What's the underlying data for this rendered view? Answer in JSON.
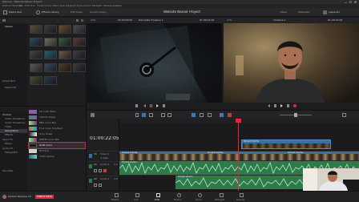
{
  "window": {
    "title": "Resolve - Website Nasser Project"
  },
  "menu": {
    "items": [
      "DaVinci Resolve",
      "File",
      "Edit",
      "Trim",
      "Timeline",
      "Clip",
      "Mark",
      "View",
      "Playback",
      "Fusion",
      "Color",
      "Fairlight",
      "Workspace",
      "Help"
    ]
  },
  "toolbar": {
    "media_pool": "Media Pool",
    "effects_library": "Effects Library",
    "edit_index": "Edit Index",
    "sound_library": "Sound Library",
    "project_name": "Website Nasser Project",
    "edit": "Edit",
    "mixer": "Mixer",
    "metadata": "Metadata",
    "inspector": "Inspector"
  },
  "media_pool": {
    "bins_header": "Master",
    "smart_bins": "Smart Bins",
    "keywords": "Keywords",
    "clip_labels": [
      "Bank 3-1",
      "",
      "",
      "",
      "",
      "",
      "",
      "",
      "",
      "",
      "",
      "",
      "",
      "",
      "",
      "",
      "",
      ""
    ]
  },
  "effects": {
    "toolbox": "Toolbox",
    "tree": [
      "Video Transitions",
      "Audio Transitions",
      "Titles",
      "Generators",
      "Effects",
      "Open FX",
      "Filters",
      "Audio FX",
      "FairlightFX"
    ],
    "favorites": "Favorites",
    "items": [
      "10 Color Bars",
      "100mV Steps",
      "EBU Color Bar",
      "Four Color Gradient",
      "Grey Scale",
      "SMPTE Color Bar",
      "Solid Color",
      "Window",
      "YCbCr Ramp"
    ],
    "item_colors": [
      "#8a5cb8",
      "#6a6f8a",
      "#4a7dbb",
      "#5aa07a",
      "#777777",
      "#a86ab0",
      "#2a2a2a",
      "#cccccc",
      "#3a8a8a"
    ],
    "selected_index": 6
  },
  "viewer": {
    "zoom": "39%",
    "source_timecode": "00:00:00:00",
    "clip_name": "Dekuddle Timeline 1",
    "program_timecode": "01:00:22:05",
    "program_zoom": "47%",
    "timeline_name": "Timeline 1"
  },
  "timeline": {
    "timecode": "01:00:22:05",
    "tracks": [
      {
        "id": "V1",
        "name": "Video 1",
        "clips": "4 Clips",
        "color": "#3b6fa0"
      },
      {
        "id": "A1",
        "name": "Audio 1",
        "level": "2.0",
        "color": "#2e7a4a"
      },
      {
        "id": "A2",
        "name": "Audio 2",
        "level": "2.0",
        "color": "#2e7a4a"
      }
    ],
    "clip_label": "Smart Cache",
    "audio_label": "Smart Audio"
  },
  "pages": [
    {
      "name": "Media",
      "icon": "media-page-icon"
    },
    {
      "name": "Cut",
      "icon": "cut-page-icon"
    },
    {
      "name": "Edit",
      "icon": "edit-page-icon"
    },
    {
      "name": "Fusion",
      "icon": "fusion-page-icon"
    },
    {
      "name": "Color",
      "icon": "color-page-icon"
    },
    {
      "name": "Fairlight",
      "icon": "fairlight-page-icon"
    },
    {
      "name": "Deliver",
      "icon": "deliver-page-icon"
    }
  ],
  "app": {
    "name": "DaVinci Resolve 16",
    "badge": "PUBLIC BETA"
  },
  "colors": {
    "accent_red": "#e0293a",
    "clip_blue": "#3b6fa0",
    "audio_green": "#2e7a4a",
    "playhead": "#e0293a"
  }
}
